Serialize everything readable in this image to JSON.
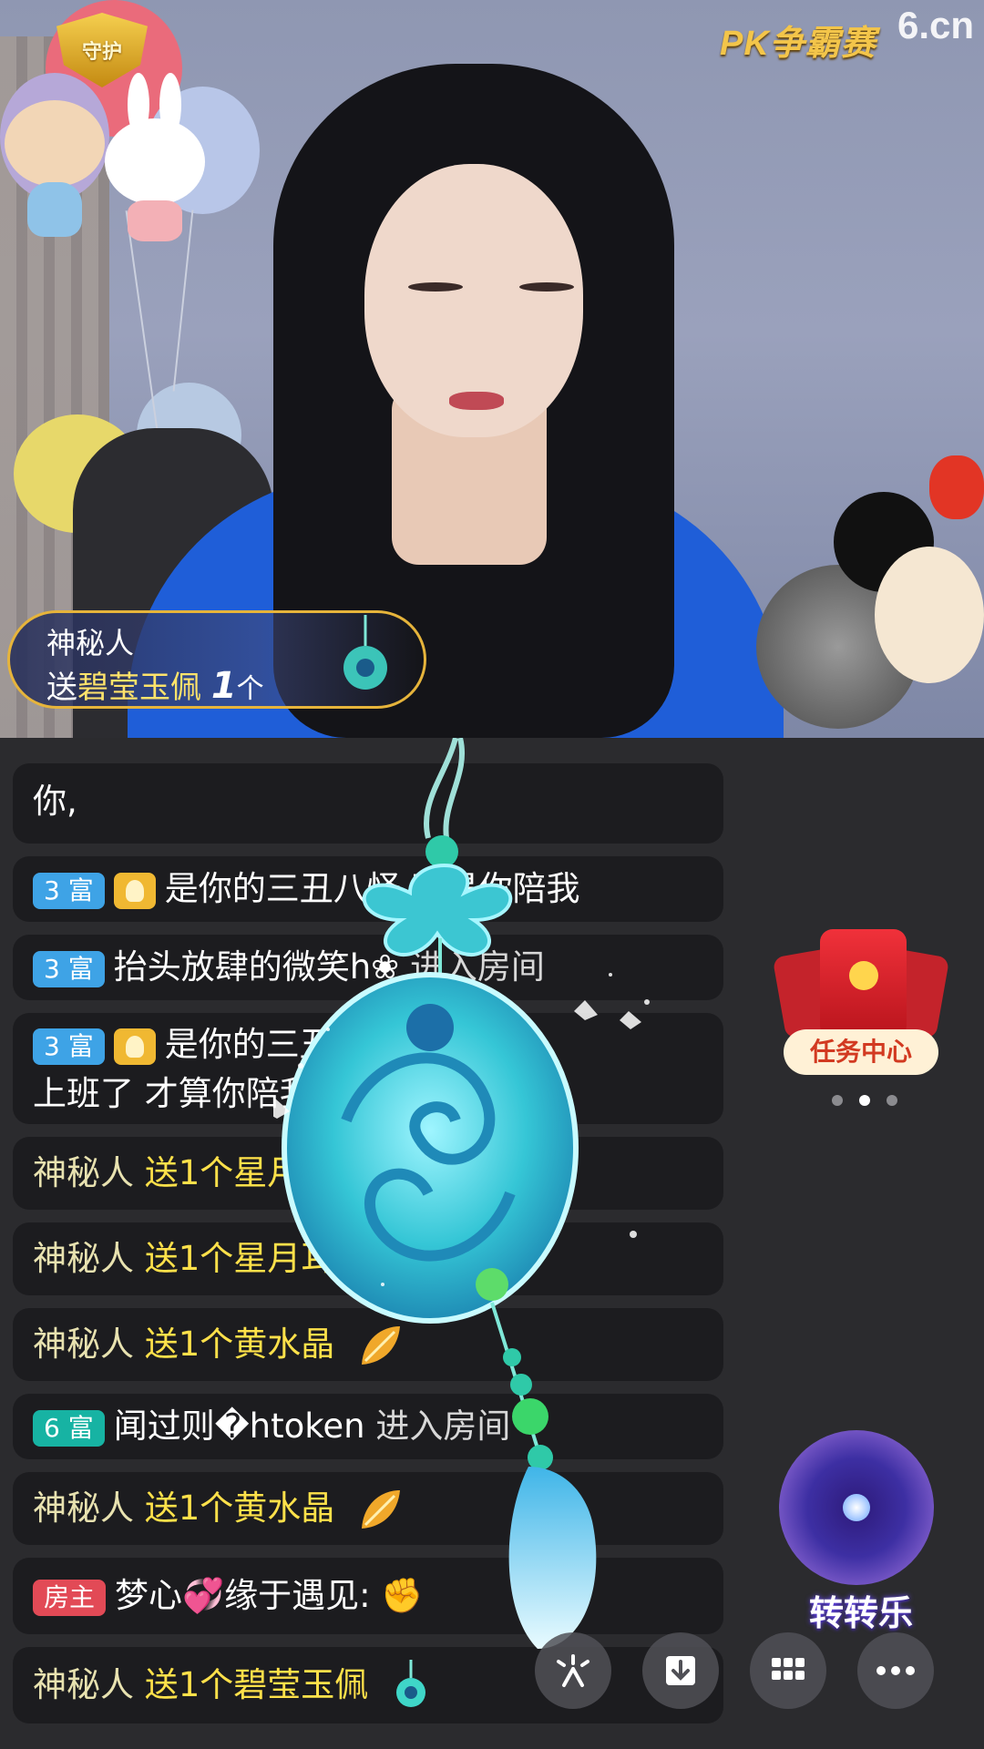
{
  "branding": {
    "guard_badge": "守护",
    "pk_logo": "PK争霸赛",
    "site_logo": "6.cn"
  },
  "gift_toast": {
    "sender": "神秘人",
    "action": "送",
    "gift_name": "碧莹玉佩",
    "count": "1",
    "unit": "个"
  },
  "chat": [
    {
      "text": "你,"
    },
    {
      "tag": "3 富",
      "has_user_icon": true,
      "text": "是你的三丑八怪    不是你陪我"
    },
    {
      "tag": "3 富",
      "name": "抬头放肆的微笑h❀",
      "system": "进入房间"
    },
    {
      "tag": "3 富",
      "has_user_icon": true,
      "text": "是你的三丑        下班 我",
      "text2": "上班了 才算你陪我"
    },
    {
      "name": "神秘人",
      "gift": "送1个星月耳"
    },
    {
      "name": "神秘人",
      "gift": "送1个星月耳"
    },
    {
      "name": "神秘人",
      "gift": "送1个黄水晶",
      "gift_icon": "leaf-gem-icon"
    },
    {
      "tag": "6 富",
      "name": "闻过则�htoken",
      "system": "进入房间"
    },
    {
      "name": "神秘人",
      "gift": "送1个黄水晶",
      "gift_icon": "leaf-gem-icon"
    },
    {
      "tag": "房主",
      "name": "梦心💞缘于遇见:",
      "emoji": "✊"
    },
    {
      "name": "神秘人",
      "gift": "送1个碧莹玉佩",
      "gift_icon": "jade-pendant-icon"
    }
  ],
  "task_center": {
    "label": "任务中心",
    "pages": 3,
    "active_page": 2
  },
  "wheel": {
    "label": "转转乐"
  },
  "bottom_bar": [
    {
      "icon": "sparkle-icon"
    },
    {
      "icon": "download-icon"
    },
    {
      "icon": "grid-icon"
    },
    {
      "icon": "more-icon"
    }
  ],
  "colors": {
    "rich3": "#3ea3e6",
    "rich6": "#17b3a3",
    "owner": "#e24a56",
    "gift_text": "#ffe14a",
    "toast_border": "#e6b43b"
  }
}
